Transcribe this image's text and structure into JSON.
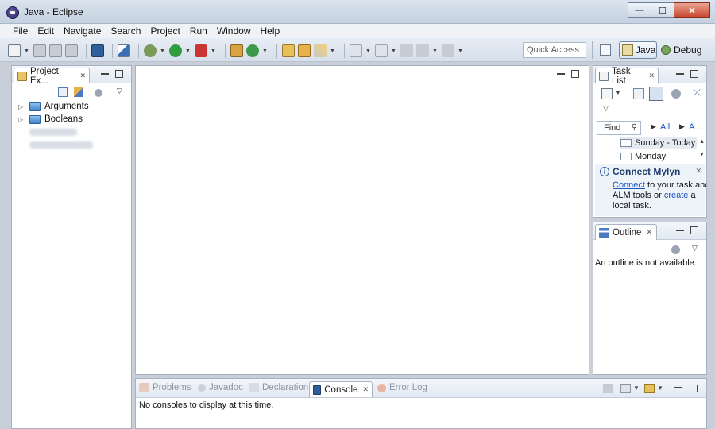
{
  "window": {
    "title": "Java - Eclipse",
    "buttons": {
      "minimize": "—",
      "maximize": "☐",
      "close": "✕"
    }
  },
  "menu": [
    "File",
    "Edit",
    "Navigate",
    "Search",
    "Project",
    "Run",
    "Window",
    "Help"
  ],
  "toolbar": {
    "quick_access_placeholder": "Quick Access",
    "perspectives": [
      "Java",
      "Debug"
    ]
  },
  "project_explorer": {
    "tab_label": "Project Ex...",
    "items": [
      "Arguments",
      "Booleans"
    ]
  },
  "task_list": {
    "tab_label": "Task List",
    "find_placeholder": "Find",
    "filter_all": "All",
    "filter_a": "A...",
    "rows": [
      "Sunday - Today",
      "Monday"
    ],
    "connect": {
      "title": "Connect Mylyn",
      "link_connect": "Connect",
      "text_1": " to your task and",
      "text_2": "ALM tools or ",
      "link_create": "create",
      "text_3": " a",
      "text_4": "local task."
    }
  },
  "outline": {
    "tab_label": "Outline",
    "message": "An outline is not available."
  },
  "bottom": {
    "tabs": [
      "Problems",
      "Javadoc",
      "Declaration",
      "Console",
      "Error Log"
    ],
    "active_tab": "Console",
    "message": "No consoles to display at this time."
  },
  "colors": {
    "accent_blue": "#1a55c0",
    "frame": "#c9cfd8"
  }
}
